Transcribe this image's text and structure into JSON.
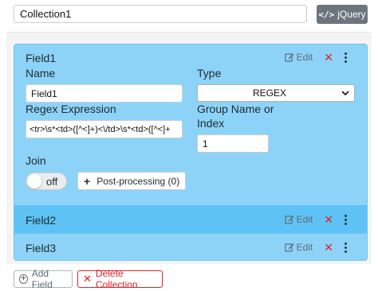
{
  "collection": {
    "name_value": "Collection1"
  },
  "toolbar": {
    "jquery_label": "jQuery",
    "jquery_icon": "code-icon"
  },
  "fields": [
    {
      "title": "Field1",
      "edit_label": "Edit",
      "expanded": true,
      "name_label": "Name",
      "name_value": "Field1",
      "type_label": "Type",
      "type_value": "REGEX",
      "regex_label": "Regex Expression",
      "regex_value": "<tr>\\s*<td>([^<]+)<\\/td>\\s*<td>([^<]+",
      "group_label_line1": "Group Name or",
      "group_label_line2": "Index",
      "group_value": "1",
      "join_label": "Join",
      "join_state": "off",
      "postproc_label": "Post-processing (0)"
    },
    {
      "title": "Field2",
      "edit_label": "Edit",
      "expanded": false,
      "highlighted": true
    },
    {
      "title": "Field3",
      "edit_label": "Edit",
      "expanded": false
    }
  ],
  "footer": {
    "add_field_label": "Add Field",
    "delete_collection_label": "Delete Collection"
  },
  "colors": {
    "panel_bg": "#8dd3f7",
    "panel_hover_bg": "#5ec3f4",
    "danger": "#e0212a",
    "secondary": "#6c757d"
  }
}
